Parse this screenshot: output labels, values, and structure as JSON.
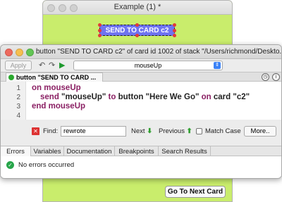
{
  "stack_window": {
    "title": "Example (1) *",
    "card_button_label": "SEND TO CARD c2",
    "go_next_label": "Go To Next Card",
    "bg_color": "#c9ed6c"
  },
  "editor": {
    "title": "button \"SEND TO CARD c2\" of card id 1002 of stack \"/Users/richmond/Deskto...",
    "toolbar": {
      "apply_label": "Apply",
      "handler_menu": "mouseUp",
      "icons": [
        "undo-icon",
        "redo-icon",
        "run-icon"
      ]
    },
    "script_tab": "button \"SEND TO CARD ...",
    "line_numbers": [
      "1",
      "2",
      "3",
      "4"
    ],
    "code": [
      {
        "tokens": [
          {
            "text": "on ",
            "class": "kw"
          },
          {
            "text": "mouseUp",
            "class": "kw"
          }
        ],
        "indent": 0
      },
      {
        "tokens": [
          {
            "text": "send ",
            "class": "kw"
          },
          {
            "text": "\"mouseUp\" ",
            "class": "str"
          },
          {
            "text": "to ",
            "class": "kw"
          },
          {
            "text": "button \"Here We Go\" ",
            "class": "str"
          },
          {
            "text": "on ",
            "class": "kw"
          },
          {
            "text": "card \"c2\"",
            "class": "str"
          }
        ],
        "indent": 1
      },
      {
        "tokens": [
          {
            "text": "end ",
            "class": "kw"
          },
          {
            "text": "mouseUp",
            "class": "kw"
          }
        ],
        "indent": 0
      }
    ],
    "find": {
      "label": "Find:",
      "value": "rewrote",
      "next_label": "Next",
      "previous_label": "Previous",
      "match_case_label": "Match Case",
      "more_label": "More.."
    },
    "bottom_tabs": [
      "Errors",
      "Variables",
      "Documentation",
      "Breakpoints",
      "Search Results"
    ],
    "status_message": "No errors occurred"
  }
}
